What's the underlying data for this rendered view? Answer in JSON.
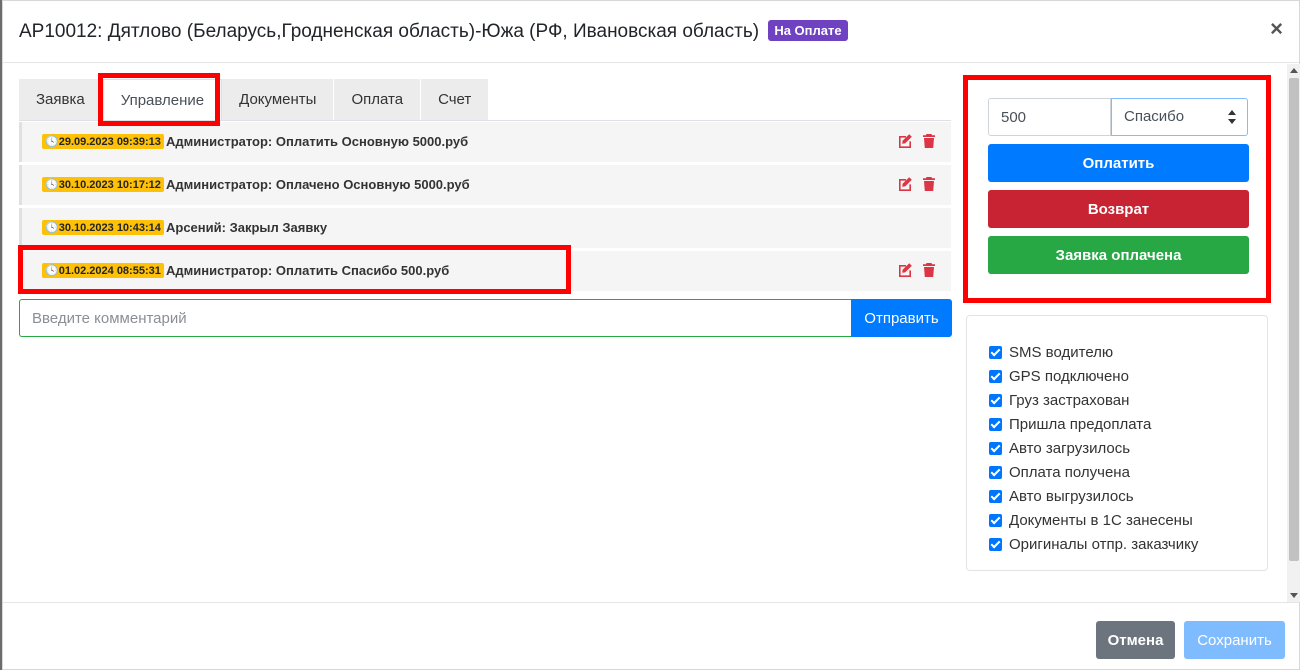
{
  "header": {
    "title": "АР10012: Дятлово (Беларусь,Гродненская область)-Южа (РФ, Ивановская область)",
    "status_badge": "На Оплате",
    "close_glyph": "×"
  },
  "tabs": [
    {
      "label": "Заявка",
      "active": false
    },
    {
      "label": "Управление",
      "active": true
    },
    {
      "label": "Документы",
      "active": false
    },
    {
      "label": "Оплата",
      "active": false
    },
    {
      "label": "Счет",
      "active": false
    }
  ],
  "history": [
    {
      "date": "29.09.2023 09:39:13",
      "text": "Администратор: Оплатить Основную 5000.руб",
      "editable": true
    },
    {
      "date": "30.10.2023 10:17:12",
      "text": "Администратор: Оплачено Основную 5000.руб",
      "editable": true
    },
    {
      "date": "30.10.2023 10:43:14",
      "text": "Арсений: Закрыл Заявку",
      "editable": false
    },
    {
      "date": "01.02.2024 08:55:31",
      "text": "Администратор: Оплатить Спасибо 500.руб",
      "editable": true
    }
  ],
  "comment": {
    "placeholder": "Введите комментарий",
    "send_label": "Отправить"
  },
  "payment": {
    "amount": "500",
    "recipient": "Спасибо",
    "pay_label": "Оплатить",
    "refund_label": "Возврат",
    "paid_label": "Заявка оплачена"
  },
  "checklist": [
    {
      "label": "SMS водителю",
      "checked": true
    },
    {
      "label": "GPS подключено",
      "checked": true
    },
    {
      "label": "Груз застрахован",
      "checked": true
    },
    {
      "label": "Пришла предоплата",
      "checked": true
    },
    {
      "label": "Авто загрузилось",
      "checked": true
    },
    {
      "label": "Оплата получена",
      "checked": true
    },
    {
      "label": "Авто выгрузилось",
      "checked": true
    },
    {
      "label": "Документы в 1С занесены",
      "checked": true
    },
    {
      "label": "Оригиналы отпр. заказчику",
      "checked": true
    }
  ],
  "footer": {
    "cancel_label": "Отмена",
    "save_label": "Сохранить"
  },
  "colors": {
    "badge": "#6f42c1",
    "date_badge": "#ffc107",
    "primary": "#007bff",
    "danger": "#c82333",
    "success": "#28a745",
    "icon_red": "#dc3545",
    "highlight": "#ff0000"
  }
}
